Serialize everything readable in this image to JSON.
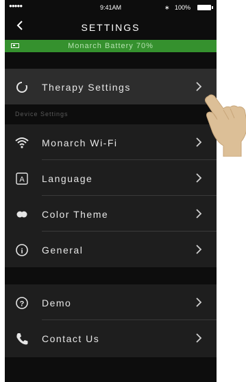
{
  "status_bar": {
    "signal": "●●●●●",
    "time": "9:41AM",
    "bluetooth": "∗",
    "battery": "100%"
  },
  "nav": {
    "title": "SETTINGS"
  },
  "banner": {
    "text": "Monarch Battery 70%",
    "color": "#35912e"
  },
  "therapy": {
    "label": "Therapy Settings",
    "icon": "circle-icon"
  },
  "device_section": {
    "header": "Device Settings",
    "items": [
      {
        "label": "Monarch Wi-Fi",
        "icon": "wifi-icon"
      },
      {
        "label": "Language",
        "icon": "language-icon",
        "glyph": "A"
      },
      {
        "label": "Color Theme",
        "icon": "color-theme-icon"
      },
      {
        "label": "General",
        "icon": "info-icon",
        "glyph": "i"
      }
    ]
  },
  "support_section": {
    "items": [
      {
        "label": "Demo",
        "icon": "help-icon",
        "glyph": "?"
      },
      {
        "label": "Contact Us",
        "icon": "phone-icon"
      }
    ]
  }
}
